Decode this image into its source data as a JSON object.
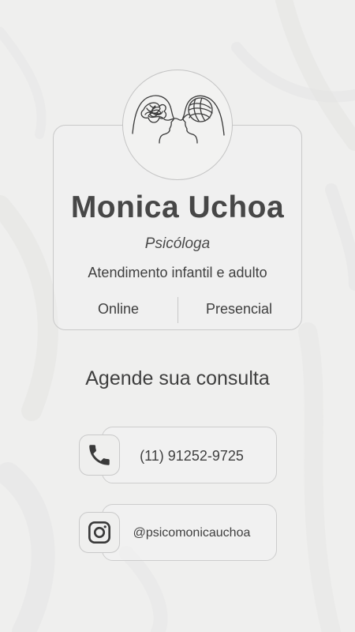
{
  "profile": {
    "name": "Monica Uchoa",
    "title": "Psicóloga",
    "description": "Atendimento infantil e adulto",
    "modes": [
      "Online",
      "Presencial"
    ],
    "logo_icon": "brain-yarn-heads-icon"
  },
  "cta": "Agende sua consulta",
  "contacts": {
    "phone": {
      "icon": "phone-icon",
      "text": "(11) 91252-9725"
    },
    "instagram": {
      "icon": "instagram-icon",
      "text": "@psicomonicauchoa"
    }
  },
  "colors": {
    "background": "#efefee",
    "text": "#3f3f3f",
    "border": "#c9c9c9"
  }
}
